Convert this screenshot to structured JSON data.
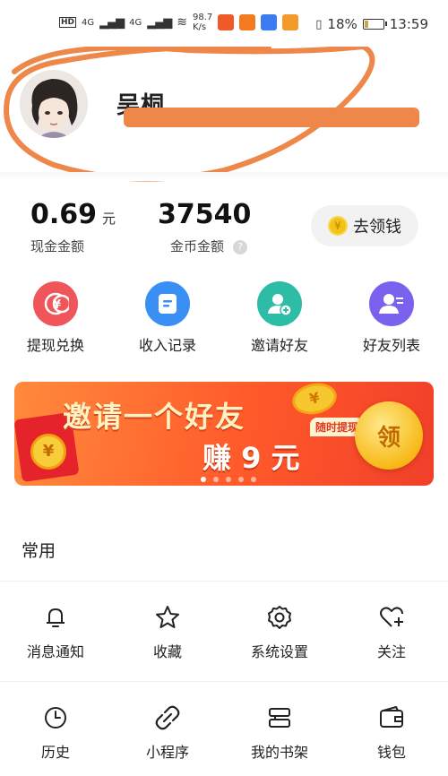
{
  "status_bar": {
    "network_1": "4G",
    "network_2": "4G",
    "speed_value": "98.7",
    "speed_unit": "K/s",
    "battery": "18%",
    "time": "13:59",
    "battery_level": 0.18
  },
  "profile": {
    "username": "吴桐",
    "username_obscured": true
  },
  "balances": {
    "cash_value": "0.69",
    "cash_unit": "元",
    "cash_label": "现金金额",
    "coin_value": "37540",
    "coin_label": "金币金额",
    "withdraw_button": "去领钱",
    "coin_symbol": "¥"
  },
  "actions": [
    {
      "label": "提现兑换",
      "icon": "coin-icon",
      "color": "#f0555a"
    },
    {
      "label": "收入记录",
      "icon": "document-icon",
      "color": "#3a8ff5"
    },
    {
      "label": "邀请好友",
      "icon": "add-user-icon",
      "color": "#2dbca6"
    },
    {
      "label": "好友列表",
      "icon": "user-list-icon",
      "color": "#7b62ee"
    }
  ],
  "banner": {
    "title": "邀请一个好友",
    "subtitle": "赚 9 元",
    "tag": "随时提现",
    "claim": "领",
    "coin_symbol": "¥",
    "slides": 5,
    "active_slide": 1
  },
  "common": {
    "section_title": "常用",
    "tools": [
      {
        "label": "消息通知",
        "icon": "bell-icon"
      },
      {
        "label": "收藏",
        "icon": "star-icon"
      },
      {
        "label": "系统设置",
        "icon": "gear-icon"
      },
      {
        "label": "关注",
        "icon": "heart-plus-icon"
      },
      {
        "label": "历史",
        "icon": "clock-icon"
      },
      {
        "label": "小程序",
        "icon": "link-icon"
      },
      {
        "label": "我的书架",
        "icon": "bookshelf-icon"
      },
      {
        "label": "钱包",
        "icon": "wallet-icon"
      }
    ]
  },
  "colors": {
    "accent_orange": "#ff5a2a",
    "annotation": "#ee874a"
  }
}
